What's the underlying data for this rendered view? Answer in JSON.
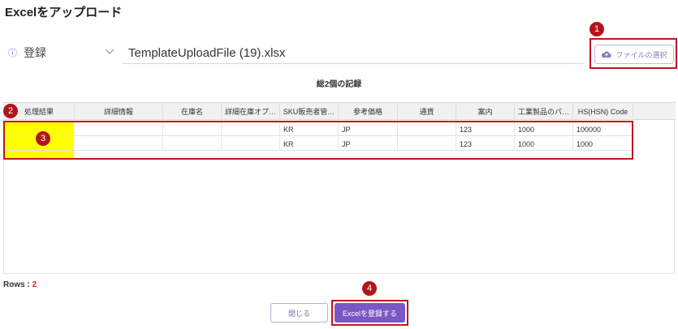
{
  "dialog": {
    "title": "Excelをアップロード"
  },
  "mode": {
    "icon": "info-circle-icon",
    "value": "登録"
  },
  "file": {
    "name": "TemplateUploadFile (19).xlsx",
    "choose_label": "ファイルの選択",
    "choose_icon": "cloud-upload-icon"
  },
  "records_label": "総2個の記録",
  "table": {
    "columns": [
      "処理結果",
      "詳細情報",
      "在庫名",
      "詳細在庫オプ…",
      "SKU販売者管…",
      "参考価格",
      "通貨",
      "案内",
      "工業製品のパ…",
      "HS(HSN) Code"
    ],
    "rows": [
      [
        "",
        "",
        "",
        "",
        "KR",
        "JP",
        "",
        "123",
        "1000",
        "100000"
      ],
      [
        "",
        "",
        "",
        "",
        "KR",
        "JP",
        "",
        "123",
        "1000",
        "1000"
      ]
    ]
  },
  "rows_count": {
    "label": "Rows :",
    "value": "2"
  },
  "buttons": {
    "close": "閉じる",
    "submit": "Excelを登録する"
  },
  "annotations": [
    "1",
    "2",
    "3",
    "4"
  ],
  "colors": {
    "accent": "#7a57c4",
    "annotation": "#c0161d",
    "highlight": "#ffff00"
  }
}
